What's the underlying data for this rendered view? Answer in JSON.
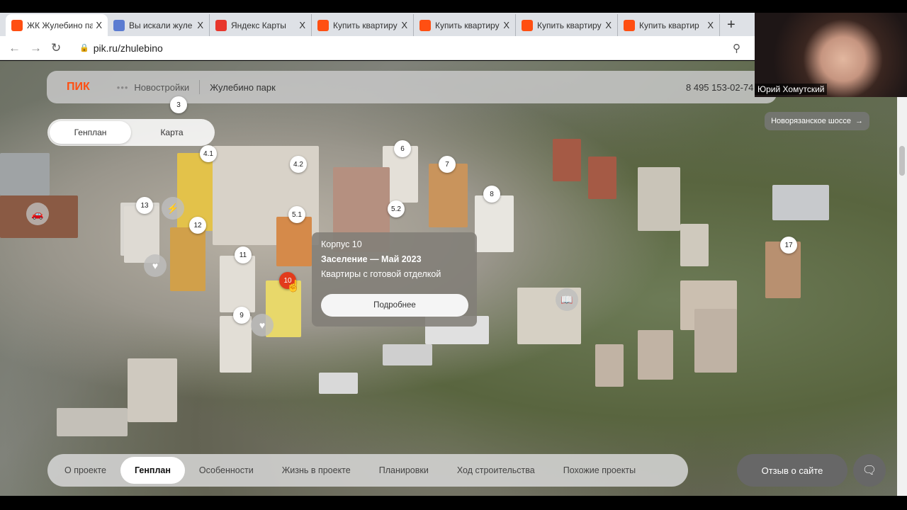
{
  "browser": {
    "tabs": [
      {
        "title": "ЖК Жулебино па",
        "icon": "pik-favicon",
        "color": "#ff4f12",
        "active": true
      },
      {
        "title": "Вы искали жуле",
        "icon": "city-favicon",
        "color": "#5a7bd1"
      },
      {
        "title": "Яндекс Карты",
        "icon": "map-pin-favicon",
        "color": "#e8362c"
      },
      {
        "title": "Купить квартиру",
        "icon": "pik-favicon",
        "color": "#ff4f12"
      },
      {
        "title": "Купить квартиру",
        "icon": "pik-favicon",
        "color": "#ff4f12"
      },
      {
        "title": "Купить квартиру",
        "icon": "pik-favicon",
        "color": "#ff4f12"
      },
      {
        "title": "Купить квартир",
        "icon": "pik-favicon",
        "color": "#ff4f12"
      }
    ],
    "close": "X",
    "new_tab": "+",
    "url": "pik.ru/zhulebino"
  },
  "header": {
    "logo": "ПИК",
    "menu_dots": "•••",
    "section": "Новостройки",
    "project": "Жулебино парк",
    "phone": "8 495 153-02-74"
  },
  "view_toggle": {
    "items": [
      "Генплан",
      "Карта"
    ],
    "active": "Генплан"
  },
  "highway": {
    "label": "Новорязанское шоссе",
    "arrow": "→"
  },
  "markers": [
    "3",
    "4.1",
    "4.2",
    "6",
    "7",
    "8",
    "13",
    "12",
    "5.1",
    "5.2",
    "11",
    "17",
    "9",
    "10"
  ],
  "selected_marker": "10",
  "poi_icons": [
    "parking-icon",
    "sport-icon",
    "heart-icon",
    "heart-icon",
    "book-icon"
  ],
  "popup": {
    "title": "Корпус 10",
    "settlement": "Заселение — Май 2023",
    "finish": "Квартиры с готовой отделкой",
    "button": "Подробнее"
  },
  "bottom_nav": {
    "items": [
      "О проекте",
      "Генплан",
      "Особенности",
      "Жизнь в проекте",
      "Планировки",
      "Ход строительства",
      "Похожие проекты"
    ],
    "active": "Генплан"
  },
  "feedback": "Отзыв о сайте",
  "webcam": {
    "name": "Юрий Хомутский"
  },
  "colors": {
    "brand": "#ff4f12",
    "marker_selected": "#e23b1c"
  }
}
